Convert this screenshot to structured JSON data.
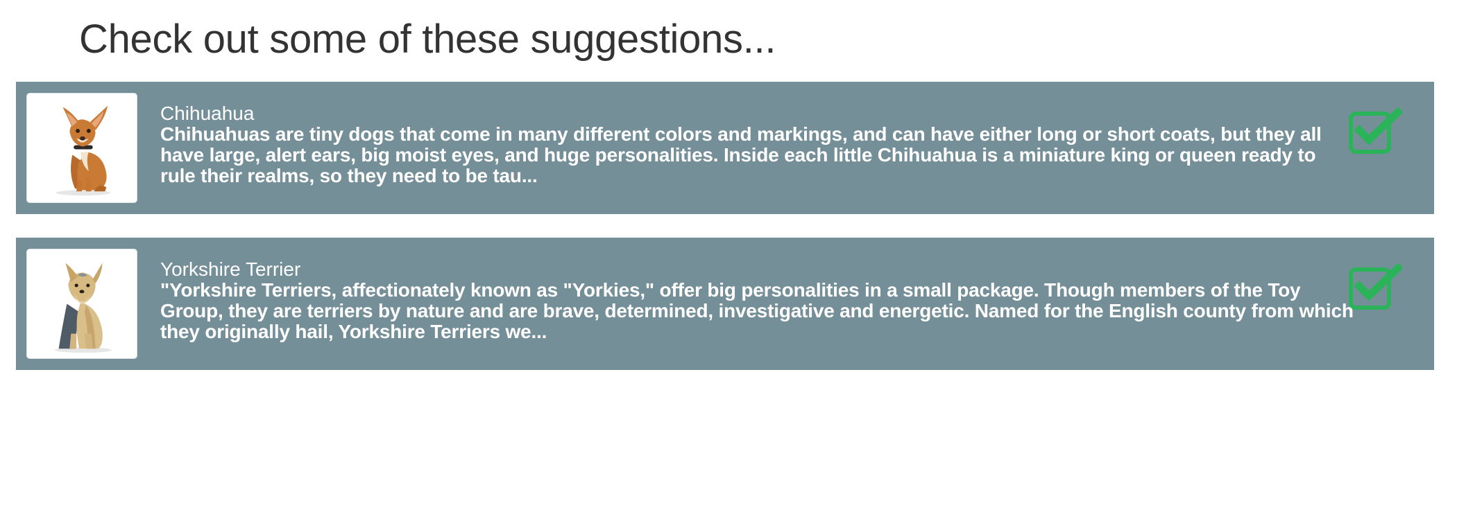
{
  "page": {
    "title": "Check out some of these suggestions..."
  },
  "colors": {
    "card_background": "#758f99",
    "check_green": "#2bb35a",
    "title_text": "#333333"
  },
  "suggestions": [
    {
      "name": "Chihuahua",
      "description": "Chihuahuas are tiny dogs that come in many different colors and markings, and can have either long or short coats, but they all have large, alert ears, big moist eyes, and huge personalities. Inside each little Chihuahua is a miniature king or queen ready to rule their realms, so they need to be tau...",
      "image": "chihuahua-photo",
      "icon": "checkbox-checked-icon"
    },
    {
      "name": "Yorkshire Terrier",
      "description": "\"Yorkshire Terriers, affectionately known as \"Yorkies,\" offer big personalities in a small package. Though members of the Toy Group, they are terriers by nature and are brave, determined, investigative and energetic. Named for the English county from which they originally hail, Yorkshire Terriers we...",
      "image": "yorkshire-terrier-photo",
      "icon": "checkbox-checked-icon"
    }
  ]
}
